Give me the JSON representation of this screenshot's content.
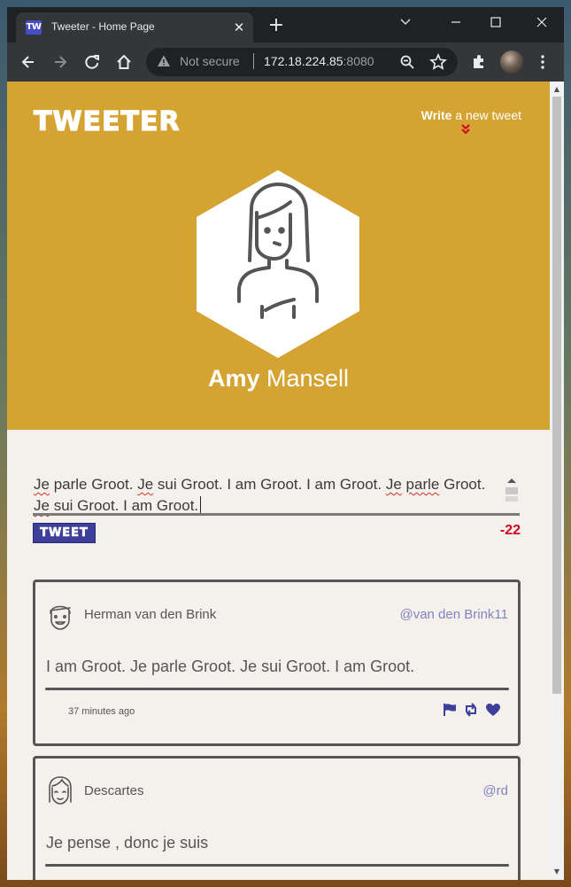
{
  "browser": {
    "tab_title": "Tweeter - Home Page",
    "tab_favicon": "TW",
    "new_tab": "+",
    "tab_close": "✕",
    "security_label": "Not secure",
    "url_host": "172.18.224.85",
    "url_port": ":8080"
  },
  "header": {
    "logo": "TWEETER",
    "write_bold": "Write",
    "write_rest": "a new tweet",
    "write_chevron": "⌄⌄",
    "profile_first": "Amy",
    "profile_last": "Mansell"
  },
  "compose": {
    "text_parts": [
      "Je",
      "parle Groot.",
      "Je",
      "sui Groot. I am Groot. I am Groot.",
      "Je",
      "parle",
      "Groot.",
      "Je",
      "sui Groot. I am Groot."
    ],
    "button_label": "TWEET",
    "counter": "-22"
  },
  "tweets": [
    {
      "name": "Herman van den Brink",
      "handle": "@van den Brink11",
      "content": "I am Groot. Je parle Groot. Je sui Groot. I am Groot.",
      "time": "37 minutes ago"
    },
    {
      "name": "Descartes",
      "handle": "@rd",
      "content": "Je pense , donc je suis"
    }
  ],
  "colors": {
    "header_bg": "#d4a332",
    "page_bg": "#f4f1ec",
    "accent": "#3d3f9a",
    "counter": "#d0021b",
    "handle": "#8183c0"
  },
  "icons": [
    "tweeter-favicon-icon",
    "close-icon",
    "plus-icon",
    "chevron-down-icon",
    "minimize-icon",
    "maximize-icon",
    "window-close-icon",
    "back-arrow-icon",
    "forward-arrow-icon",
    "reload-icon",
    "home-icon",
    "warning-icon",
    "zoom-icon",
    "star-icon",
    "extensions-icon",
    "menu-icon",
    "flag-icon",
    "retweet-icon",
    "heart-icon"
  ]
}
